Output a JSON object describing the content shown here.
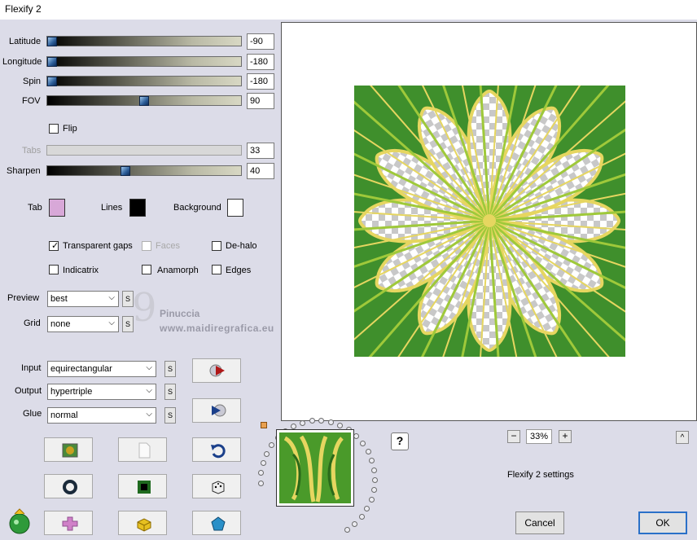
{
  "window": {
    "title": "Flexify 2"
  },
  "sliders": [
    {
      "label": "Latitude",
      "value": "-90",
      "fraction": 0.0
    },
    {
      "label": "Longitude",
      "value": "-180",
      "fraction": 0.0
    },
    {
      "label": "Spin",
      "value": "-180",
      "fraction": 0.0
    },
    {
      "label": "FOV",
      "value": "90",
      "fraction": 0.5
    },
    {
      "label": "Tabs",
      "value": "33",
      "fraction": 0.0,
      "disabled": true
    },
    {
      "label": "Sharpen",
      "value": "40",
      "fraction": 0.4
    }
  ],
  "flip": {
    "label": "Flip",
    "checked": false
  },
  "colors": {
    "tab": {
      "label": "Tab",
      "color": "#d8a8d8"
    },
    "lines": {
      "label": "Lines",
      "color": "#000000"
    },
    "background": {
      "label": "Background",
      "color": "#ffffff"
    }
  },
  "options": {
    "transparent_gaps": {
      "label": "Transparent gaps",
      "checked": true
    },
    "faces": {
      "label": "Faces",
      "checked": false,
      "disabled": true
    },
    "de_halo": {
      "label": "De-halo",
      "checked": false
    },
    "indicatrix": {
      "label": "Indicatrix",
      "checked": false
    },
    "anamorph": {
      "label": "Anamorph",
      "checked": false
    },
    "edges": {
      "label": "Edges",
      "checked": false
    }
  },
  "preview_select": {
    "label": "Preview",
    "value": "best"
  },
  "grid_select": {
    "label": "Grid",
    "value": "none"
  },
  "input_select": {
    "label": "Input",
    "value": "equirectangular"
  },
  "output_select": {
    "label": "Output",
    "value": "hypertriple"
  },
  "glue_select": {
    "label": "Glue",
    "value": "normal"
  },
  "small_button": "S",
  "watermark": {
    "name": "Pinuccia",
    "url": "www.maidiregrafica.eu"
  },
  "zoom": {
    "minus": "−",
    "value": "33%",
    "plus": "+"
  },
  "collapse_label": "^",
  "help_label": "?",
  "settings_label": "Flexify 2 settings",
  "cancel_label": "Cancel",
  "ok_label": "OK",
  "accent": {
    "thumb": "#2b5c98",
    "art_green": "#2f8a2a",
    "art_yellow": "#e6d660",
    "art_lime": "#9fc93a"
  }
}
